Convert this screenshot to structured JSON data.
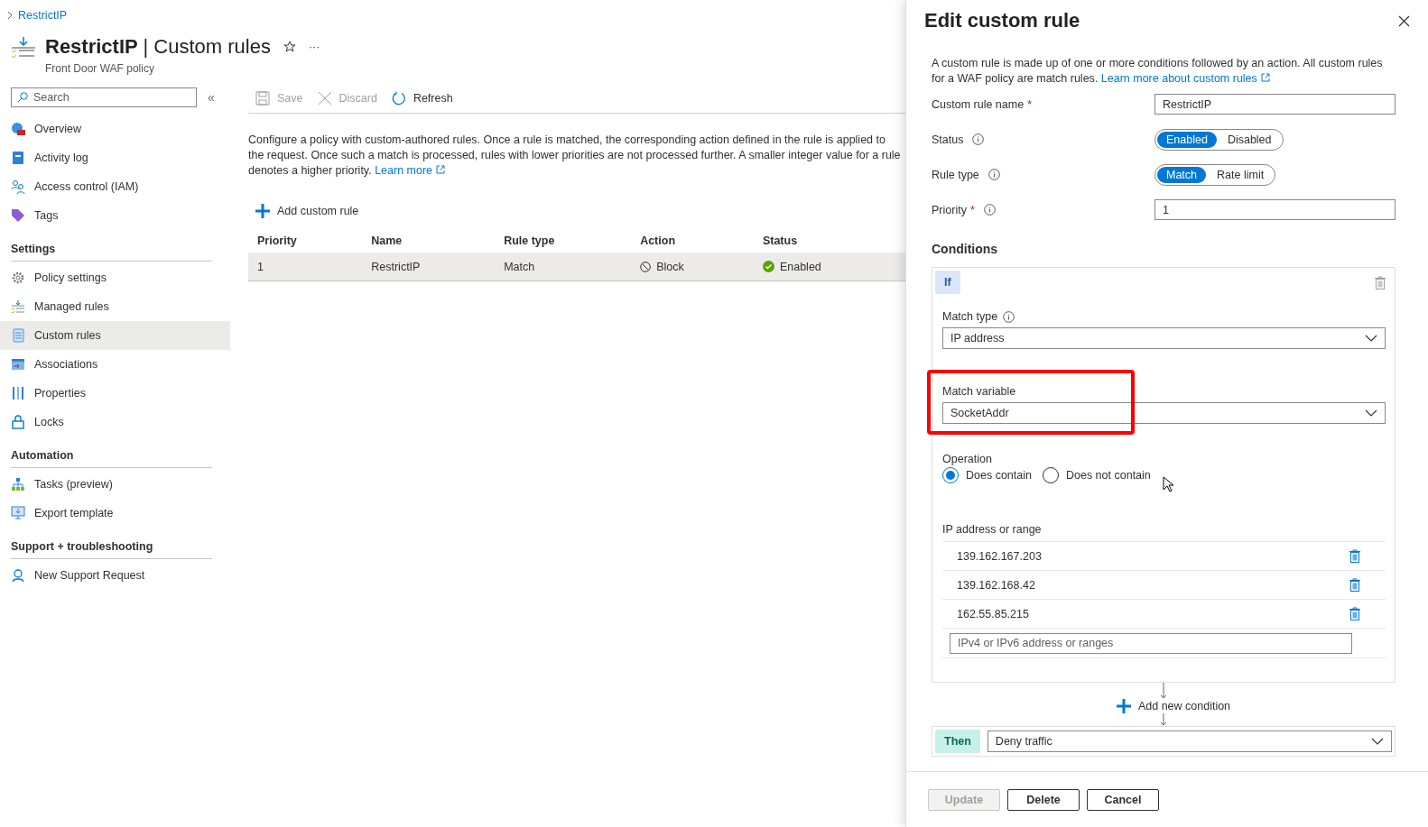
{
  "breadcrumb": [
    "RestrictIP"
  ],
  "header": {
    "title": "RestrictIP",
    "separator": "|",
    "page": "Custom rules",
    "subtitle": "Front Door WAF policy",
    "more": "···"
  },
  "sidebar": {
    "search_placeholder": "Search",
    "collapse": "«",
    "sections": [
      {
        "items": [
          {
            "label": "Overview",
            "selected": false
          },
          {
            "label": "Activity log",
            "selected": false
          },
          {
            "label": "Access control (IAM)",
            "selected": false
          },
          {
            "label": "Tags",
            "selected": false
          }
        ]
      },
      {
        "title": "Settings",
        "items": [
          {
            "label": "Policy settings",
            "selected": false
          },
          {
            "label": "Managed rules",
            "selected": false
          },
          {
            "label": "Custom rules",
            "selected": true
          },
          {
            "label": "Associations",
            "selected": false
          },
          {
            "label": "Properties",
            "selected": false
          },
          {
            "label": "Locks",
            "selected": false
          }
        ]
      },
      {
        "title": "Automation",
        "items": [
          {
            "label": "Tasks (preview)",
            "selected": false
          },
          {
            "label": "Export template",
            "selected": false
          }
        ]
      },
      {
        "title": "Support + troubleshooting",
        "items": [
          {
            "label": "New Support Request",
            "selected": false
          }
        ]
      }
    ]
  },
  "toolbar": [
    {
      "label": "Save",
      "disabled": true
    },
    {
      "label": "Discard",
      "disabled": true
    },
    {
      "label": "Refresh",
      "disabled": false
    }
  ],
  "description": {
    "text": "Configure a policy with custom-authored rules. Once a rule is matched, the corresponding action defined in the rule is applied to the request. Once such a match is processed, rules with lower priorities are not processed further. A smaller integer value for a rule denotes a higher priority.",
    "link": "Learn more"
  },
  "add_rule": "Add custom rule",
  "table": {
    "columns": [
      "Priority",
      "Name",
      "Rule type",
      "Action",
      "Status"
    ],
    "rows": [
      {
        "priority": "1",
        "name": "RestrictIP",
        "rule_type": "Match",
        "action": "Block",
        "status": "Enabled",
        "selected": true
      }
    ]
  },
  "panel": {
    "title": "Edit custom rule",
    "description": {
      "text": "A custom rule is made up of one or more conditions followed by an action. All custom rules for a WAF policy are match rules.",
      "link": "Learn more about custom rules"
    },
    "fields": [
      {
        "kind": "text",
        "label": "Custom rule name",
        "required_mark": "*",
        "info": false,
        "value": "RestrictIP"
      },
      {
        "kind": "toggle",
        "label": "Status",
        "info": true,
        "options": [
          {
            "label": "Enabled",
            "selected": true
          },
          {
            "label": "Disabled",
            "selected": false
          }
        ]
      },
      {
        "kind": "toggle",
        "label": "Rule type",
        "info": true,
        "options": [
          {
            "label": "Match",
            "selected": true
          },
          {
            "label": "Rate limit",
            "selected": false
          }
        ]
      },
      {
        "kind": "text",
        "label": "Priority",
        "required_mark": "*",
        "info": true,
        "value": "1"
      }
    ],
    "conditions_title": "Conditions",
    "condition": {
      "badge": "If",
      "match_type": {
        "label": "Match type",
        "info": true,
        "value": "IP address",
        "highlighted": false
      },
      "match_variable": {
        "label": "Match variable",
        "info": false,
        "value": "SocketAddr",
        "highlighted": true
      },
      "operation": {
        "label": "Operation",
        "options": [
          {
            "label": "Does contain",
            "selected": true
          },
          {
            "label": "Does not contain",
            "selected": false
          }
        ]
      },
      "ip_list": {
        "label": "IP address or range",
        "items": [
          "139.162.167.203",
          "139.162.168.42",
          "162.55.85.215"
        ],
        "placeholder": "IPv4 or IPv6 address or ranges"
      }
    },
    "add_condition": "Add new condition",
    "then": {
      "badge": "Then",
      "value": "Deny traffic"
    },
    "buttons": [
      {
        "label": "Update",
        "disabled": true
      },
      {
        "label": "Delete",
        "disabled": false
      },
      {
        "label": "Cancel",
        "disabled": false
      }
    ]
  }
}
